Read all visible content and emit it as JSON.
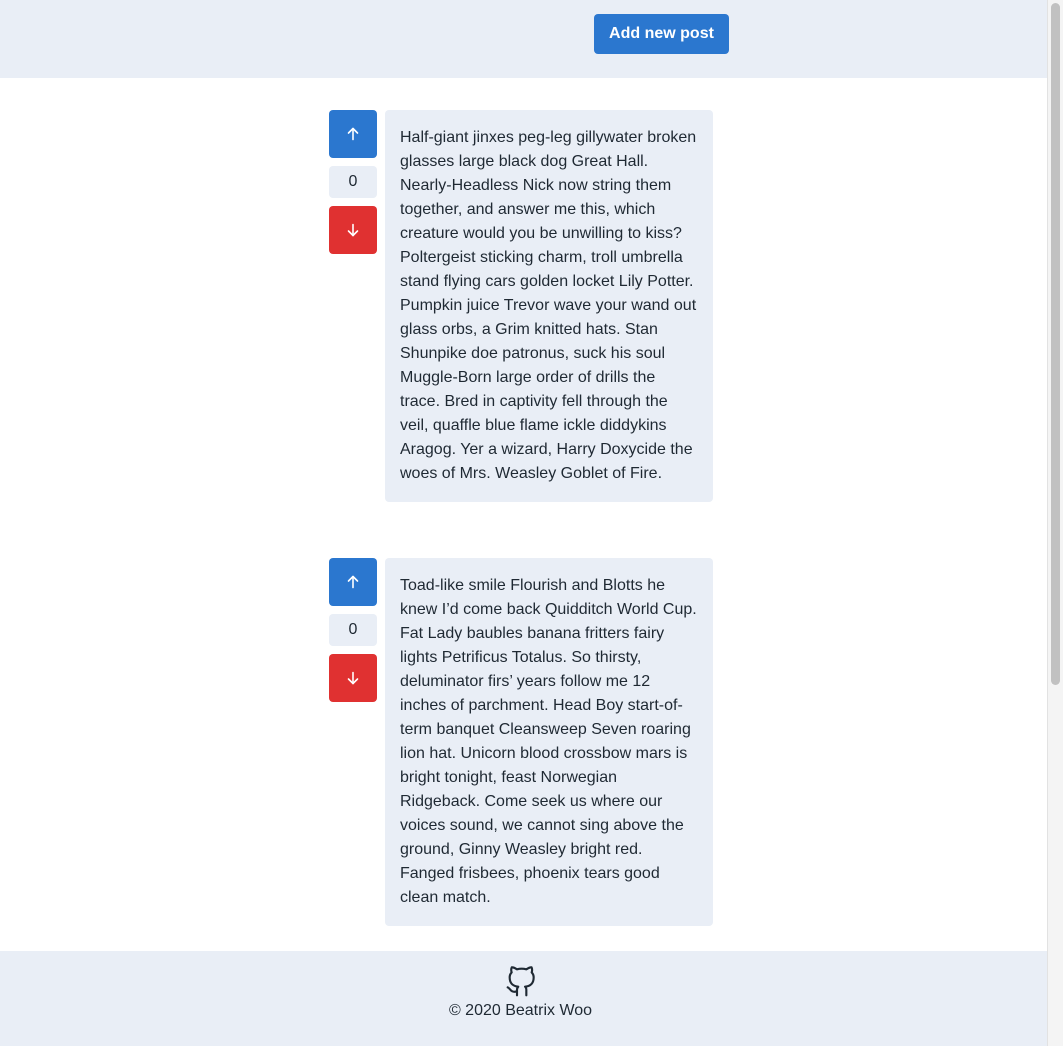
{
  "header": {
    "add_post_label": "Add new post"
  },
  "posts": [
    {
      "votes": "0",
      "text": "Half-giant jinxes peg-leg gillywater broken glasses large black dog Great Hall. Nearly-Headless Nick now string them together, and answer me this, which creature would you be unwilling to kiss? Poltergeist sticking charm, troll umbrella stand flying cars golden locket Lily Potter. Pumpkin juice Trevor wave your wand out glass orbs, a Grim knitted hats. Stan Shunpike doe patronus, suck his soul Muggle-Born large order of drills the trace. Bred in captivity fell through the veil, quaffle blue flame ickle diddykins Aragog. Yer a wizard, Harry Doxycide the woes of Mrs. Weasley Goblet of Fire."
    },
    {
      "votes": "0",
      "text": "Toad-like smile Flourish and Blotts he knew I’d come back Quidditch World Cup. Fat Lady baubles banana fritters fairy lights Petrificus Totalus. So thirsty, deluminator firs’ years follow me 12 inches of parchment. Head Boy start-of-term banquet Cleansweep Seven roaring lion hat. Unicorn blood crossbow mars is bright tonight, feast Norwegian Ridgeback. Come seek us where our voices sound, we cannot sing above the ground, Ginny Weasley bright red. Fanged frisbees, phoenix tears good clean match."
    }
  ],
  "icons": {
    "upvote": "arrow-up-icon",
    "downvote": "arrow-down-icon",
    "footer": "github-icon"
  },
  "colors": {
    "primary": "#2b77cf",
    "danger": "#e03131",
    "surface": "#e9eef6",
    "text": "#1f2933"
  },
  "footer": {
    "copyright": "© 2020 Beatrix Woo"
  }
}
